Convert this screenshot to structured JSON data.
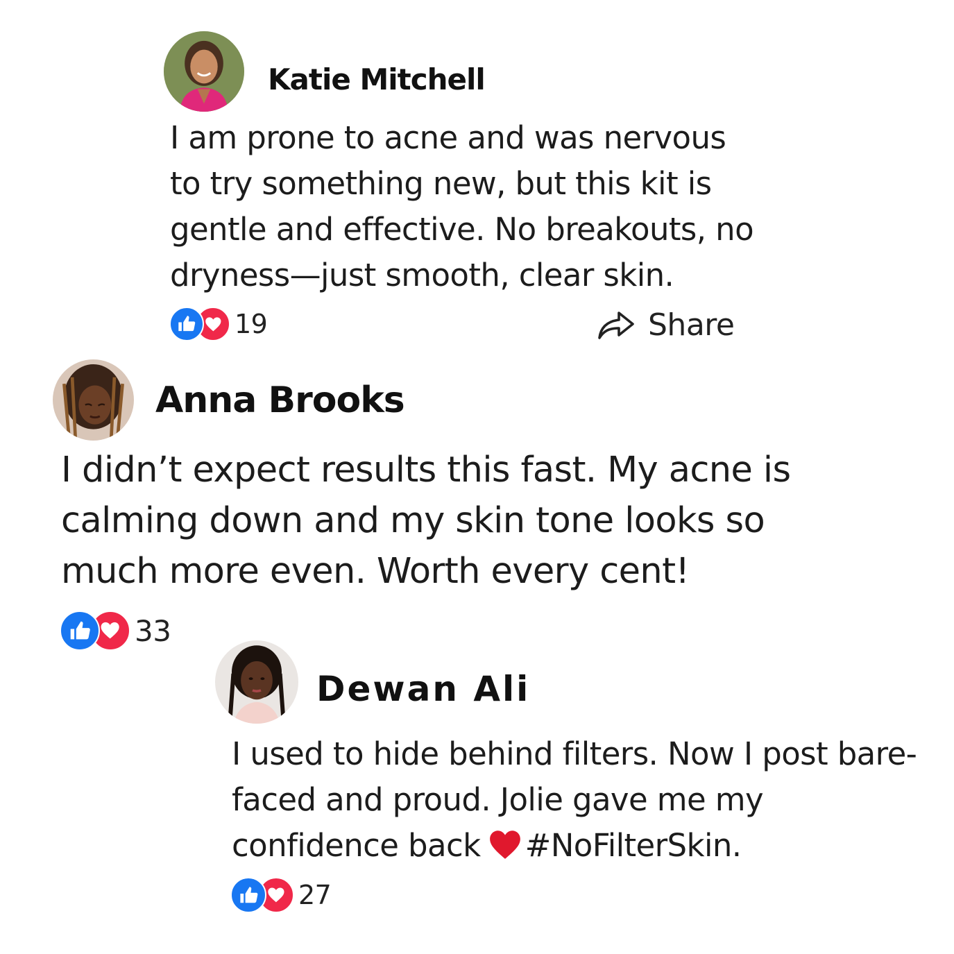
{
  "comments": [
    {
      "author": "Katie Mitchell",
      "lines": [
        "I am prone to acne and was nervous",
        "to try something new, but this kit is",
        "gentle and effective. No breakouts, no",
        "dryness—just smooth, clear skin."
      ],
      "reaction_count": "19",
      "share_label": "Share"
    },
    {
      "author": "Anna Brooks",
      "lines": [
        "I didn’t expect results this fast. My acne is",
        "calming down and my skin tone looks so",
        "much more even. Worth every cent!"
      ],
      "reaction_count": "33"
    },
    {
      "author": "Dewan Ali",
      "lines": [
        "I used to hide behind filters. Now I post bare-",
        "faced and proud. Jolie gave me my"
      ],
      "last_line_before_emoji": "confidence back",
      "last_line_after_emoji": "#NoFilterSkin.",
      "reaction_count": "27"
    }
  ],
  "icons": {
    "like": "thumbs-up-icon",
    "love": "heart-icon",
    "share": "share-arrow-icon",
    "emoji": "red-heart-emoji"
  },
  "colors": {
    "like_blue": "#1877f2",
    "love_red": "#f02849",
    "emoji_red": "#e0182d"
  }
}
